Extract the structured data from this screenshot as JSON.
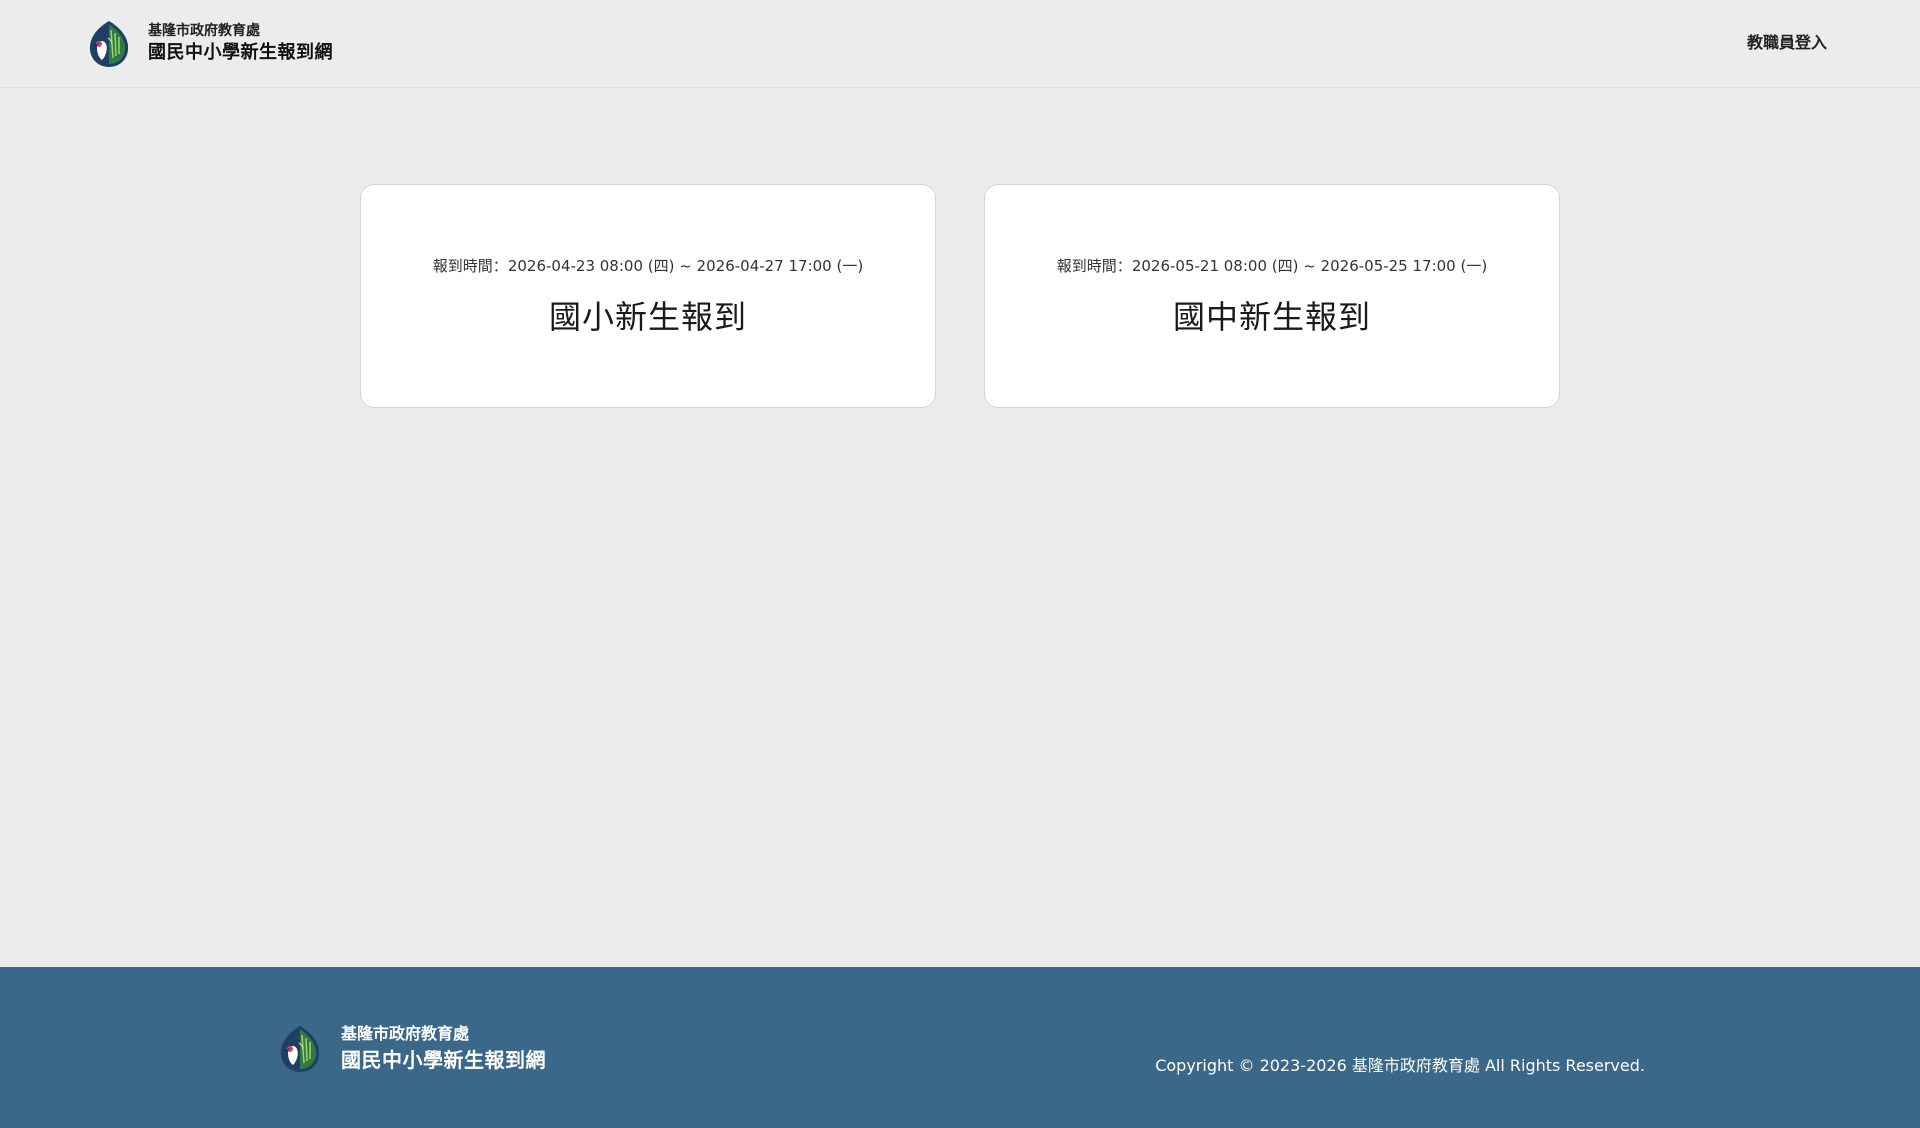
{
  "header": {
    "brand_sub": "基隆市政府教育處",
    "brand_main": "國民中小學新生報到網",
    "login_label": "教職員登入"
  },
  "cards": [
    {
      "period_label": "報到時間：",
      "period_value": "2026-04-23 08:00 (四) ~ 2026-04-27 17:00 (一)",
      "title": "國小新生報到"
    },
    {
      "period_label": "報到時間：",
      "period_value": "2026-05-21 08:00 (四) ~ 2026-05-25 17:00 (一)",
      "title": "國中新生報到"
    }
  ],
  "footer": {
    "brand_sub": "基隆市政府教育處",
    "brand_main": "國民中小學新生報到網",
    "copyright": "Copyright © 2023-2026 基隆市政府教育處 All Rights Reserved."
  },
  "colors": {
    "background": "#ececec",
    "footer": "#3b6789",
    "card": "#ffffff"
  },
  "icons": {
    "logo": "keelung-education-emblem"
  }
}
